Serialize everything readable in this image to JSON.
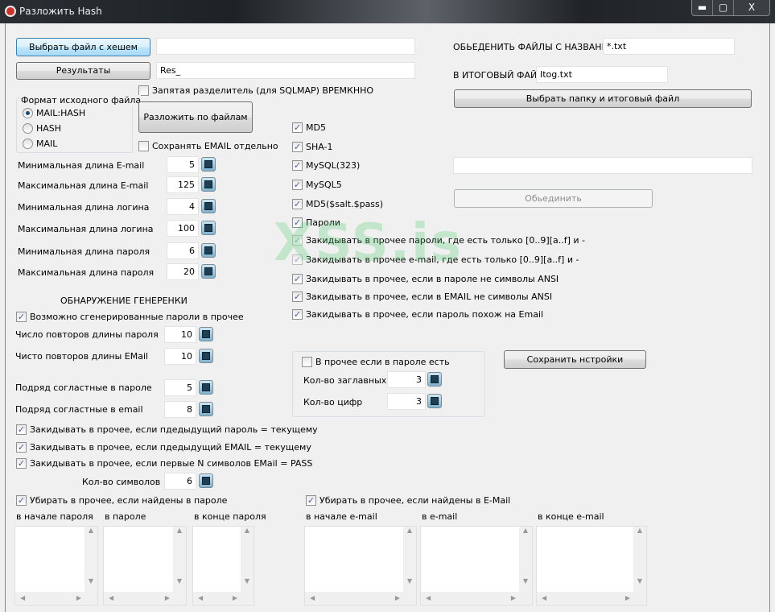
{
  "window": {
    "title": "Разложить Hash",
    "minimize": "▬",
    "maximize": "▢",
    "close": "X"
  },
  "watermark": "XSS.is",
  "top": {
    "choose_hash_button": "Выбрать файл с хешем",
    "hash_path": "",
    "results_button": "Результаты",
    "results_prefix": "Res_",
    "comma_separator": {
      "label": "Запятая разделитель (для SQLMAP) ВРЕМКННО",
      "checked": false
    },
    "split_button": "Разложить по файлам",
    "save_email": {
      "label": "Сохранять EMAIL отдельно",
      "checked": false
    }
  },
  "format": {
    "title": "Формат исходного файла",
    "options": [
      {
        "label": "MAIL:HASH",
        "selected": true
      },
      {
        "label": "HASH",
        "selected": false
      },
      {
        "label": "MAIL",
        "selected": false
      }
    ]
  },
  "lengths": [
    {
      "label": "Минимальная длина E-mail",
      "value": "5"
    },
    {
      "label": "Максимальная длина E-mail",
      "value": "125"
    },
    {
      "label": "Минимальная длина логина",
      "value": "4"
    },
    {
      "label": "Максимальная длина логина",
      "value": "100"
    },
    {
      "label": "Минимальная длина пароля",
      "value": "6"
    },
    {
      "label": "Максимальная длина пароля",
      "value": "20"
    }
  ],
  "generic": {
    "heading": "ОБНАРУЖЕНИЕ ГЕНЕРЕНКИ",
    "possibly_generated": {
      "label": "Возможно сгенерированные пароли в прочее",
      "checked": true
    },
    "fields": [
      {
        "label": "Число повторов длины пароля",
        "value": "10"
      },
      {
        "label": "Чисто повторов длины EMail",
        "value": "10"
      },
      {
        "label": "Подряд согластные в пароле",
        "value": "5"
      },
      {
        "label": "Подряд согластные в email",
        "value": "8"
      }
    ],
    "checks": [
      {
        "label": "Закидывать в прочее, если пдедыдущий пароль = текущему",
        "checked": true
      },
      {
        "label": "Закидывать в прочее, если пдедыдущий EMAIL = текущему",
        "checked": true
      },
      {
        "label": "Закидывать в прочее, если первые N символов EMail = PASS",
        "checked": true
      }
    ],
    "symbols": {
      "label": "Кол-во символов",
      "value": "6"
    }
  },
  "hash_types": [
    {
      "label": "MD5",
      "checked": true
    },
    {
      "label": "SHA-1",
      "checked": true
    },
    {
      "label": "MySQL(323)",
      "checked": true
    },
    {
      "label": "MySQL5",
      "checked": true
    },
    {
      "label": "MD5($salt.$pass)",
      "checked": true
    },
    {
      "label": "Пароли",
      "checked": true
    },
    {
      "label": "Закидывать в прочее пароли, где есть только [0..9][a..f] и -",
      "checked": true
    },
    {
      "label": "Закидывать в прочее e-mail, где есть только [0..9][a..f] и -",
      "checked": true
    },
    {
      "label": "Закидывать в прочее, если в пароле не символы ANSI",
      "checked": true
    },
    {
      "label": "Закидывать в прочее, если в EMAIL не символы ANSI",
      "checked": true
    },
    {
      "label": "Закидывать в прочее, если пароль похож на Email",
      "checked": true
    }
  ],
  "other_group": {
    "check": {
      "label": "В прочее если в пароле есть",
      "checked": false
    },
    "uppercase": {
      "label": "Кол-во заглавных",
      "value": "3"
    },
    "digits": {
      "label": "Кол-во цифр",
      "value": "3"
    }
  },
  "save_settings_button": "Сохранить нстройки",
  "merge": {
    "label": "ОБЬЕДЕНИТЬ ФАЙЛЫ С НАЗВАНИЕМ",
    "pattern": "*.txt",
    "result_label": "В ИТОГОВЫЙ ФАЙЛ",
    "result_file": "Itog.txt",
    "choose_button": "Выбрать папку и итоговый файл",
    "folder_path": "",
    "merge_button": "Обьединить"
  },
  "remove_password": {
    "label": "Убирать в прочее, если найдены в пароле",
    "checked": true,
    "lists": [
      "в начале пароля",
      "в пароле",
      "в конце пароля"
    ]
  },
  "remove_email": {
    "label": "Убирать в прочее, если найдены в E-Mail",
    "checked": true,
    "lists": [
      "в начале e-mail",
      "в e-mail",
      "в конце e-mail"
    ]
  }
}
